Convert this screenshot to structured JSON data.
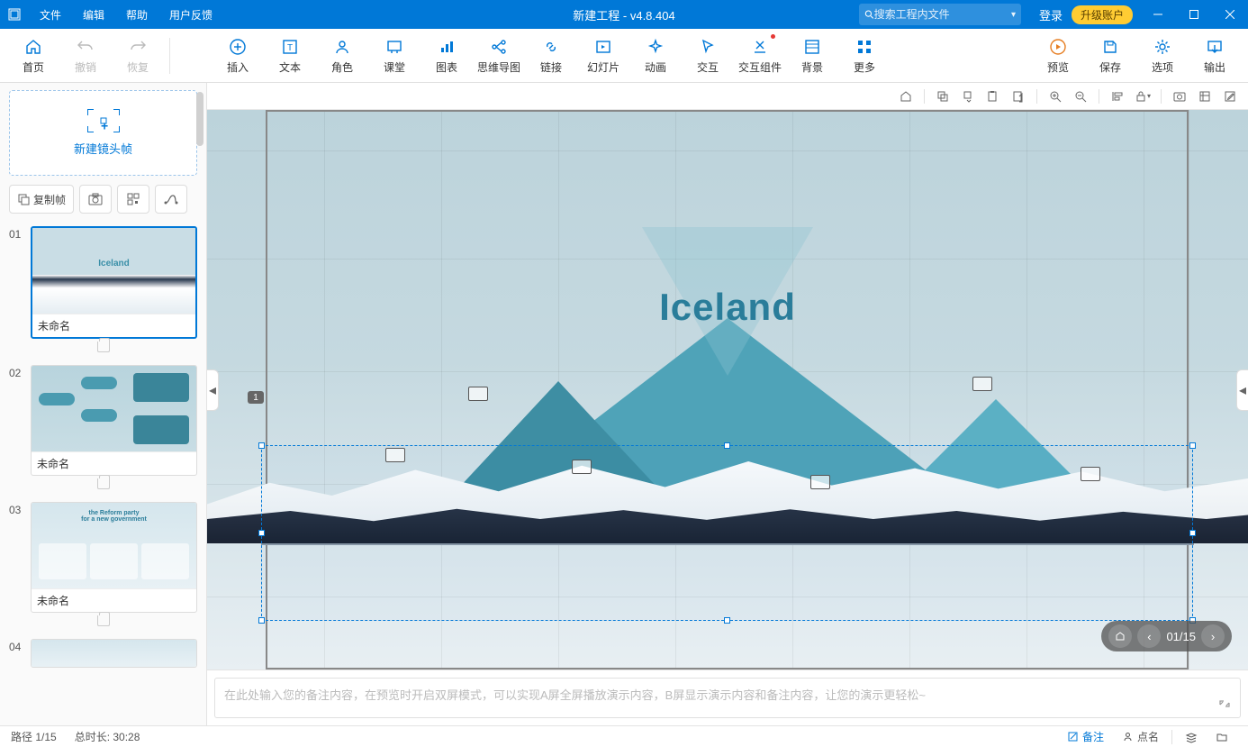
{
  "title_bar": {
    "menus": [
      "文件",
      "编辑",
      "帮助",
      "用户反馈"
    ],
    "title": "新建工程 - v4.8.404",
    "search_placeholder": "搜索工程内文件",
    "login": "登录",
    "upgrade": "升级账户"
  },
  "ribbon": {
    "home": "首页",
    "undo": "撤销",
    "redo": "恢复",
    "insert": "插入",
    "text": "文本",
    "role": "角色",
    "classroom": "课堂",
    "chart": "图表",
    "mindmap": "思维导图",
    "link": "链接",
    "slide": "幻灯片",
    "animation": "动画",
    "interact": "交互",
    "widget": "交互组件",
    "background": "背景",
    "more": "更多",
    "preview": "预览",
    "save": "保存",
    "options": "选项",
    "export": "输出"
  },
  "sidebar": {
    "new_frame": "新建镜头帧",
    "copy_frame": "复制帧",
    "slides": [
      {
        "num": "01",
        "name": "未命名",
        "selected": true,
        "preview_title": "Iceland"
      },
      {
        "num": "02",
        "name": "未命名",
        "selected": false
      },
      {
        "num": "03",
        "name": "未命名",
        "selected": false
      },
      {
        "num": "04",
        "name": ""
      }
    ]
  },
  "canvas": {
    "title": "Iceland",
    "frame_marker": "1",
    "nav_counter": "01/15"
  },
  "notes": {
    "placeholder": "在此处输入您的备注内容，在预览时开启双屏模式，可以实现A屏全屏播放演示内容，B屏显示演示内容和备注内容，让您的演示更轻松~"
  },
  "status": {
    "path": "路径 1/15",
    "duration": "总时长: 30:28",
    "notes_btn": "备注",
    "roll_btn": "点名"
  }
}
